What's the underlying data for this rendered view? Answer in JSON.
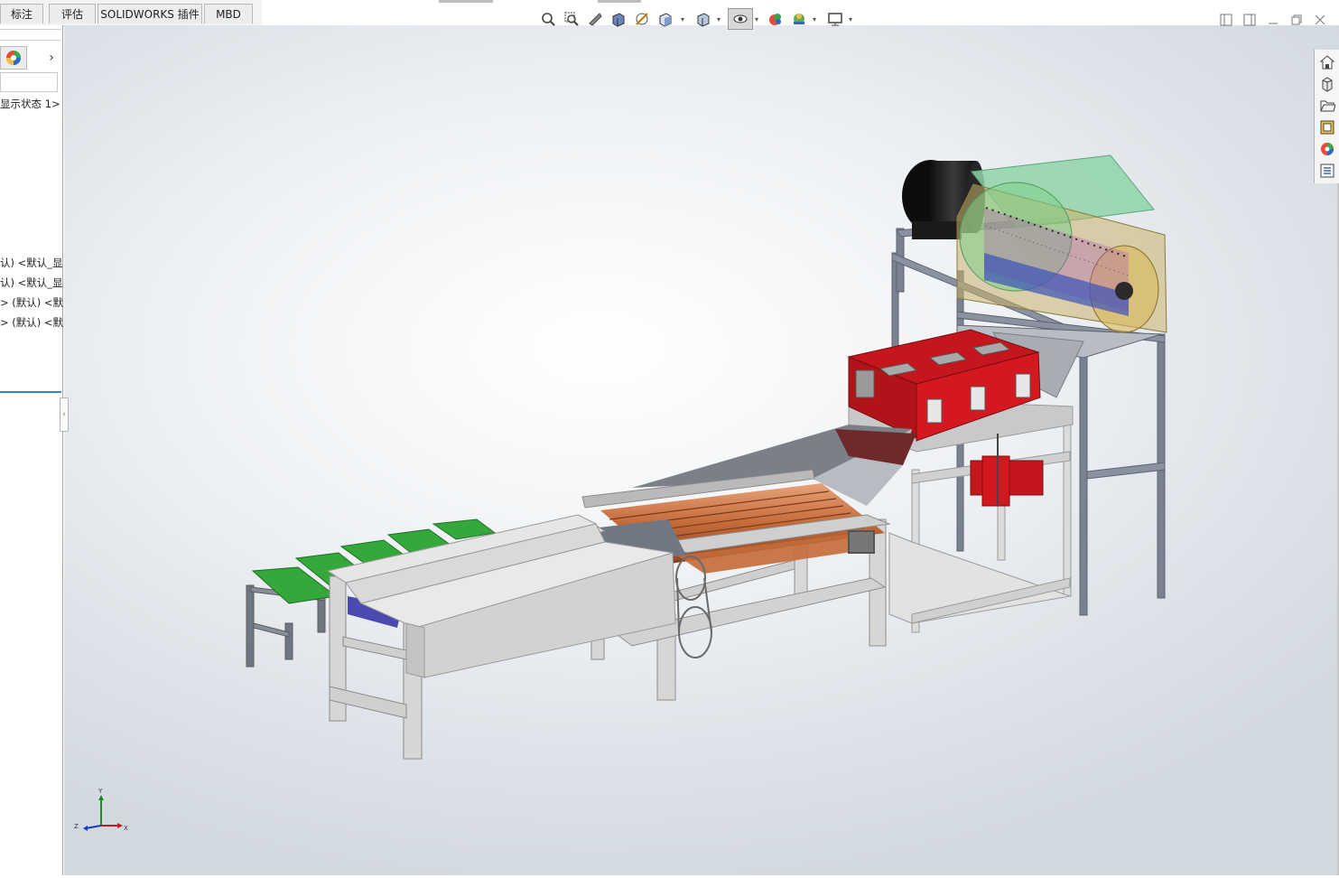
{
  "command_tabs": [
    {
      "label": "标注"
    },
    {
      "label": "评估"
    },
    {
      "label": "SOLIDWORKS 插件"
    },
    {
      "label": "MBD"
    }
  ],
  "view_toolbar": {
    "icons": [
      "zoom-to-fit-icon",
      "zoom-to-area-icon",
      "previous-view-icon",
      "section-view-icon",
      "dynamic-annotation-icon",
      "view-orientation-icon",
      "display-style-icon",
      "hide-show-items-icon",
      "edit-appearance-icon",
      "apply-scene-icon",
      "view-settings-icon"
    ]
  },
  "feature_manager": {
    "display_state": "显示状态 1>",
    "components": [
      {
        "label": "认) <默认_显"
      },
      {
        "label": "认) <默认_显"
      },
      {
        "label": "> (默认) <默认"
      },
      {
        "label": "> (默认) <默认"
      }
    ]
  },
  "task_pane": {
    "icons": [
      "solidworks-resources-icon",
      "design-library-icon",
      "file-explorer-icon",
      "view-palette-icon",
      "appearances-scenes-icon",
      "custom-properties-icon"
    ]
  },
  "triad": {
    "x_label": "X",
    "y_label": "Y",
    "z_label": "Z"
  },
  "colors": {
    "frame_red": "#c4161c",
    "hopper_green": "#8fd3a8",
    "roller_orange": "#c46a3a",
    "conveyor_green": "#35a83c",
    "frame_gray": "#d6d6d6",
    "slate": "#6f7683",
    "selection_blue": "#2f87c9"
  }
}
